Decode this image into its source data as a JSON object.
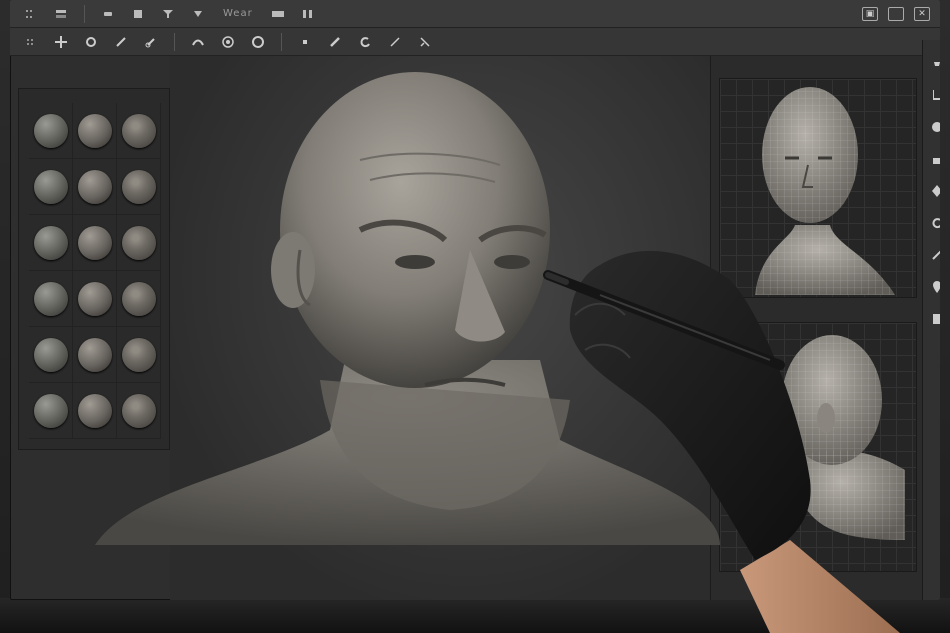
{
  "app": {
    "menu_label": "Wear"
  },
  "toolbar_top": {
    "icons": [
      "grid-icon",
      "layers-icon",
      "brush-icon",
      "document-icon",
      "funnel-icon",
      "triangle-down-icon",
      "panel-icon",
      "columns-icon"
    ]
  },
  "toolbar_second": {
    "icons": [
      "dots-icon",
      "move-icon",
      "scale-icon",
      "rotate-icon",
      "link-icon",
      "smooth-icon",
      "spiral-icon",
      "circle-icon",
      "tool-icon",
      "brush-icon",
      "loop-icon",
      "pen-icon",
      "eraser-icon"
    ]
  },
  "window_controls": [
    "screenshot-icon",
    "restore-icon",
    "close-icon"
  ],
  "brush_palette": {
    "count": 18,
    "icons": [
      "standard-brush",
      "clay-brush",
      "dam-standard-brush",
      "move-brush",
      "inflate-brush",
      "trim-brush",
      "smooth-brush",
      "pinch-brush",
      "crease-brush",
      "flatten-brush",
      "polish-brush",
      "slash-brush",
      "blob-brush",
      "layer-brush",
      "nudge-brush",
      "snake-hook-brush",
      "rake-brush",
      "noise-brush"
    ]
  },
  "right_rail": {
    "icons": [
      "lamp-icon",
      "boot-icon",
      "sphere-icon",
      "hand-icon",
      "cube-icon",
      "refresh-icon",
      "pen-icon",
      "pin-icon",
      "sheet-icon"
    ]
  },
  "colors": {
    "ui_dark": "#2e2e2e",
    "toolbar": "#3a3a3a",
    "clay": "#8e8a83",
    "glove": "#1a1a1a",
    "skin": "#b88664"
  }
}
